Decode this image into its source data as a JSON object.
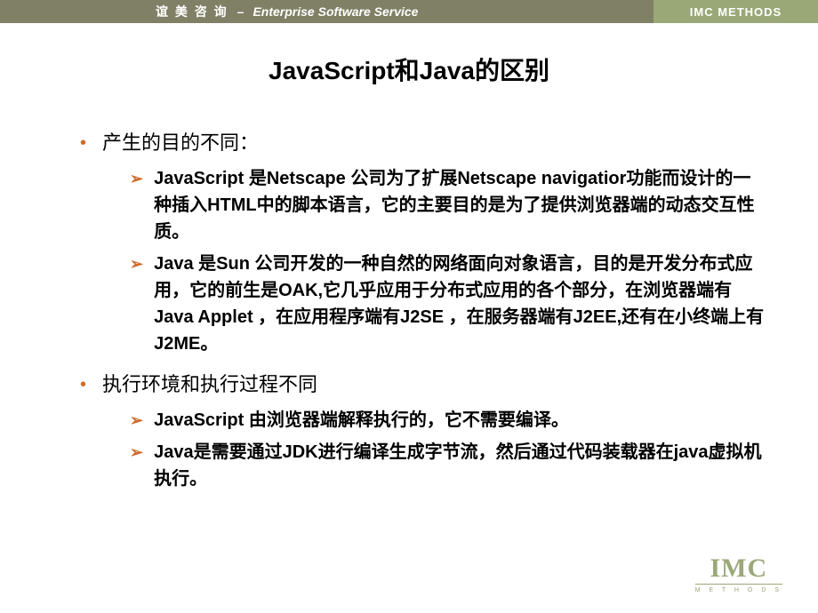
{
  "header": {
    "left_cn": "谊 美 咨 询",
    "dash": "–",
    "left_en": "Enterprise Software Service",
    "right": "IMC METHODS"
  },
  "title": "JavaScript和Java的区别",
  "bullets": [
    {
      "text": "产生的目的不同：",
      "subs": [
        "JavaScript 是Netscape 公司为了扩展Netscape navigatior功能而设计的一种插入HTML中的脚本语言，它的主要目的是为了提供浏览器端的动态交互性质。",
        "Java 是Sun 公司开发的一种自然的网络面向对象语言，目的是开发分布式应用，它的前生是OAK,它几乎应用于分布式应用的各个部分，在浏览器端有Java Applet ，在应用程序端有J2SE ，在服务器端有J2EE,还有在小终端上有J2ME。"
      ]
    },
    {
      "text": "执行环境和执行过程不同",
      "subs": [
        "JavaScript 由浏览器端解释执行的，它不需要编译。",
        "Java是需要通过JDK进行编译生成字节流，然后通过代码装载器在java虚拟机执行。"
      ]
    }
  ],
  "logo": {
    "main": "IMC",
    "sub": "M  E  T  H  O  D  S"
  }
}
